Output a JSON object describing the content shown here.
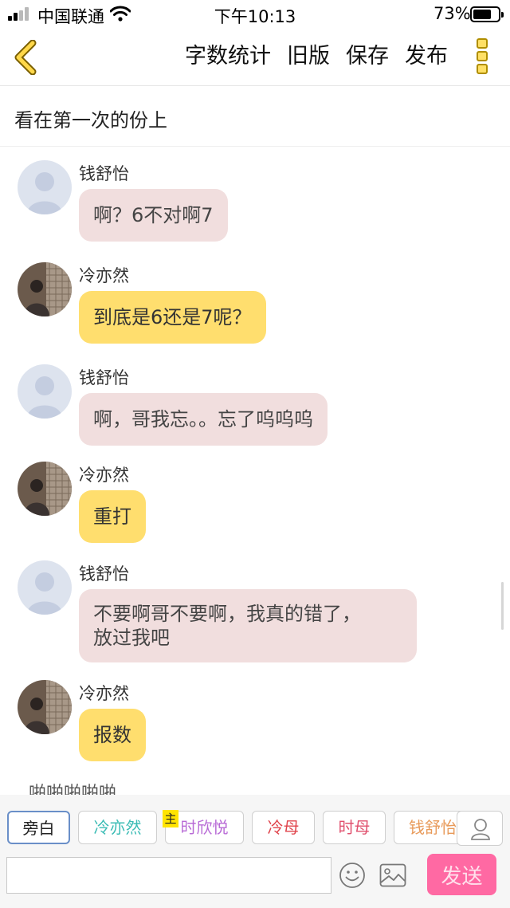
{
  "status_bar": {
    "carrier": "中国联通",
    "time": "下午10:13",
    "battery_percent": "73%",
    "battery_level": 0.73,
    "icons": [
      "signal-icon",
      "wifi-icon",
      "battery-icon"
    ]
  },
  "toolbar": {
    "back_icon": "chevron-left-icon",
    "word_count": "字数统计",
    "old_version": "旧版",
    "save": "保存",
    "publish": "发布",
    "more_icon": "more-vertical-icon",
    "more_icon_color": "#ffe066"
  },
  "story": {
    "title": "看在第一次的份上"
  },
  "messages": [
    {
      "sender": "钱舒怡",
      "text": "啊？6不对啊7",
      "bubble_color": "#f1dede",
      "avatar": "default-avatar"
    },
    {
      "sender": "冷亦然",
      "text": "到底是6还是7呢？",
      "bubble_color": "#ffde6e",
      "avatar": "photo-avatar"
    },
    {
      "sender": "钱舒怡",
      "text": "啊，哥我忘。。忘了呜呜呜",
      "bubble_color": "#f1dede",
      "avatar": "default-avatar"
    },
    {
      "sender": "冷亦然",
      "text": "重打",
      "bubble_color": "#ffde6e",
      "avatar": "photo-avatar"
    },
    {
      "sender": "钱舒怡",
      "text": "不要啊哥不要啊，我真的错了，",
      "text2": "放过我吧",
      "bubble_color": "#f1dede",
      "avatar": "default-avatar"
    },
    {
      "sender": "冷亦然",
      "text": "报数",
      "bubble_color": "#ffde6e",
      "avatar": "photo-avatar"
    }
  ],
  "narration": "啪啪啪啪啪",
  "characters": [
    {
      "name": "旁白",
      "color": "#222222",
      "selected": true
    },
    {
      "name": "冷亦然",
      "color": "#3bbcb5"
    },
    {
      "name": "时欣悦",
      "color": "#b86bd6"
    },
    {
      "name": "冷母",
      "color": "#e0444c"
    },
    {
      "name": "时母",
      "color": "#e0506e"
    },
    {
      "name": "钱舒怡",
      "color": "#e89a5a"
    }
  ],
  "main_badge": "主",
  "composer": {
    "input_value": "",
    "emoji_icon": "emoji-icon",
    "image_icon": "image-icon",
    "person_icon": "person-icon",
    "send": "发送",
    "send_color": "#ff69a3"
  }
}
